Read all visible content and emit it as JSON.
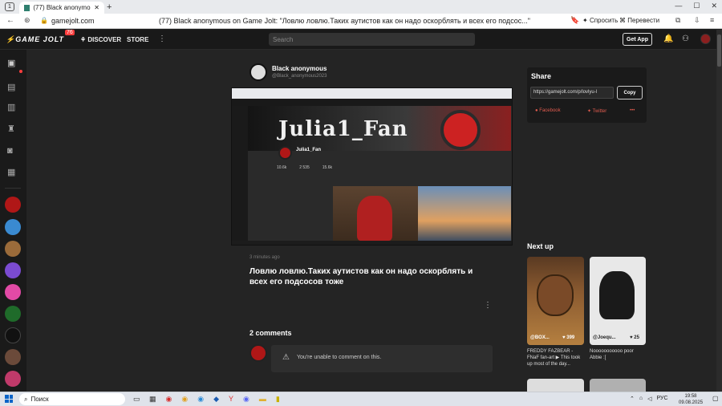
{
  "browser": {
    "tab_count": "1",
    "tab_title": "(77) Black anonymous on Game Jolt",
    "url": "gamejolt.com",
    "page_title": "(77) Black anonymous on Game Jolt: \"Ловлю ловлю.Таких аутистов как он надо оскорблять и всех его подсос...\"",
    "ask_label": "Спросить",
    "translate_label": "Перевести"
  },
  "header": {
    "logo": "GAME JOLT",
    "badge": "76",
    "discover": "DISCOVER",
    "store": "STORE",
    "search_placeholder": "Search",
    "get_app": "Get App"
  },
  "post": {
    "author_name": "Black anonymous",
    "author_handle": "@Black_anonymous2023",
    "time": "3 minutes ago",
    "text": "Ловлю ловлю.Таких аутистов как он надо оскорблять и всех его подсосов тоже",
    "comments_title": "2 comments",
    "comment_notice": "You're unable to comment on this."
  },
  "embedded": {
    "banner_text": "Julia1_Fan",
    "profile_name": "Julia1_Fan",
    "stats": [
      "10.6k",
      "2 535",
      "15.6k"
    ]
  },
  "share": {
    "title": "Share",
    "link": "https://gamejolt.com/p/lovlyu-l",
    "copy": "Copy",
    "facebook": "Facebook",
    "twitter": "Twitter",
    "more": "•••"
  },
  "next_up": {
    "title": "Next up",
    "cards": [
      {
        "user": "@BOX...",
        "likes": "399",
        "caption": "FREDDY FAZBEAR - FNaF fan-art ▶ This took up most of the day..."
      },
      {
        "user": "@Joequ...",
        "likes": "25",
        "caption": "Nooooooooooo poor Abbie :["
      }
    ]
  },
  "taskbar": {
    "search": "Поиск",
    "lang": "РУС",
    "time": "19:58",
    "date": "09.08.2025"
  },
  "colors": {
    "accent": "#ccff00",
    "brand_red": "#ff3e3e",
    "facebook": "#e15c4f",
    "twitter": "#e15c4f"
  }
}
